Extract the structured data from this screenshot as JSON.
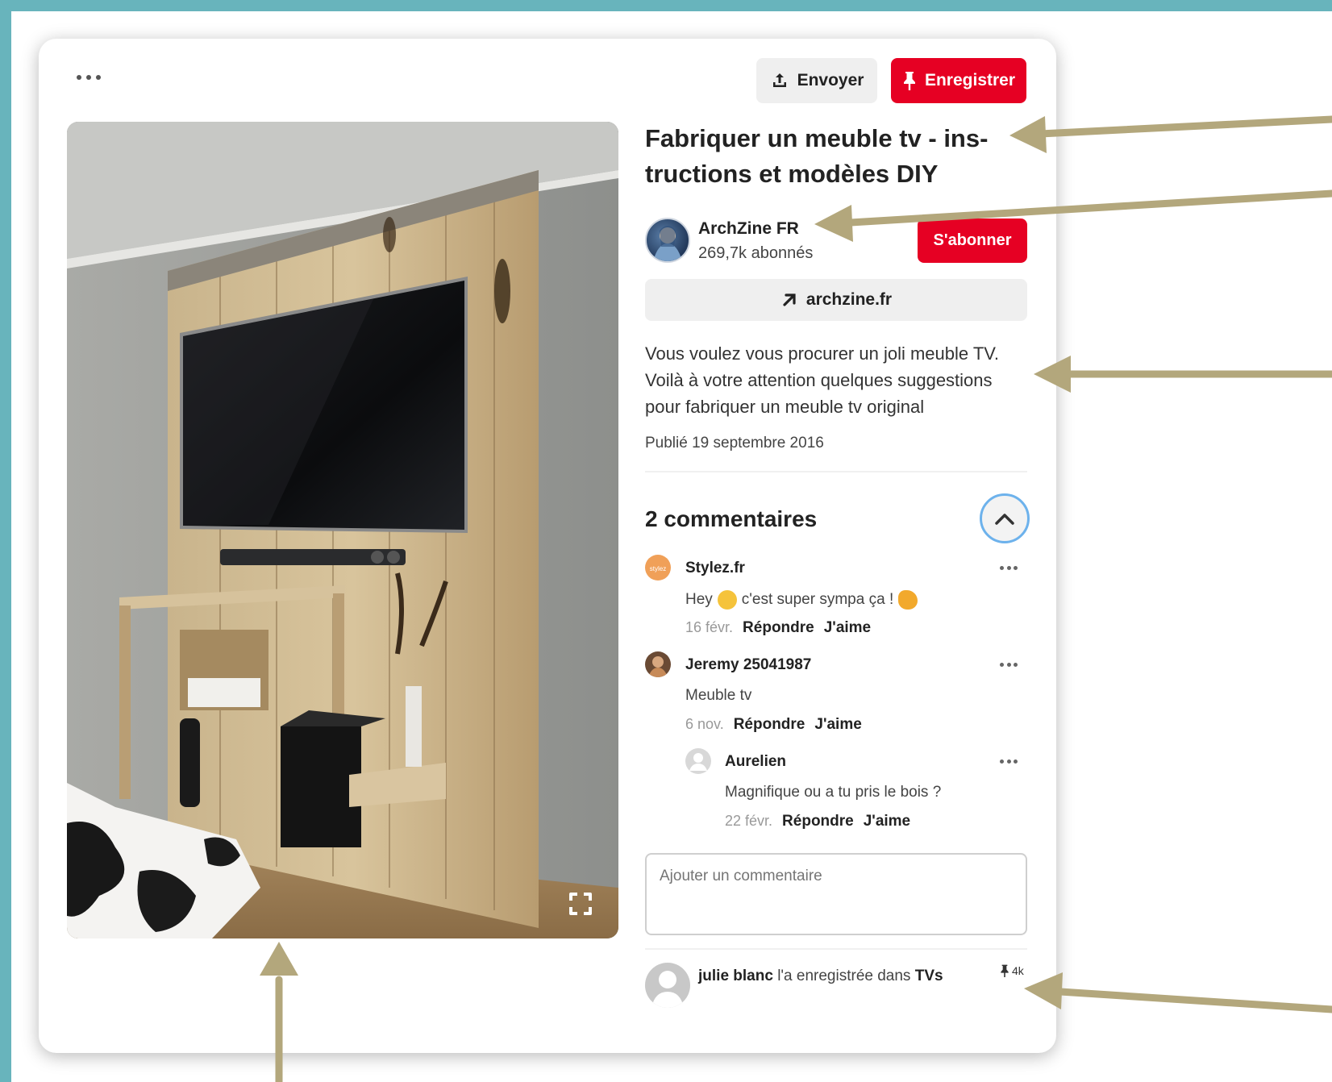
{
  "pin": {
    "send_label": "Envoyer",
    "save_label": "Enregistrer",
    "title": "Fabriquer un meuble tv - ins-tructions et modèles DIY",
    "author": {
      "name": "ArchZine FR",
      "followers": "269,7k abonnés"
    },
    "follow_label": "S'abonner",
    "link_label": "archzine.fr",
    "description": "Vous voulez vous procurer un joli meuble TV. Voilà à votre attention quelques suggestions pour fabriquer un meuble tv original",
    "published": "Publié 19 septembre 2016"
  },
  "comments": {
    "title": "2 commentaires",
    "items": [
      {
        "name": "Stylez.fr",
        "text_before": "Hey",
        "text_middle": "c'est super sympa ça !",
        "date": "16 févr.",
        "reply": "Répondre",
        "like": "J'aime"
      },
      {
        "name": "Jeremy 25041987",
        "text": "Meuble tv",
        "date": "6 nov.",
        "reply": "Répondre",
        "like": "J'aime"
      },
      {
        "name": "Aurelien",
        "text": "Magnifique ou a tu pris le bois ?",
        "date": "22 févr.",
        "reply": "Répondre",
        "like": "J'aime"
      }
    ],
    "input_placeholder": "Ajouter un commentaire"
  },
  "saved_by": {
    "user": "julie blanc",
    "text": "l'a enregistrée dans",
    "board": "TVs",
    "count": "4k"
  },
  "colors": {
    "accent_red": "#e60023",
    "frame_teal": "#68b4bc",
    "arrow_gold": "#b3a77c",
    "focus_blue": "#6db2ec"
  },
  "icons": [
    "share-icon",
    "pin-icon",
    "arrow-up-right-icon",
    "chevron-up-icon",
    "expand-icon",
    "more-dots-icon",
    "user-placeholder-icon"
  ]
}
